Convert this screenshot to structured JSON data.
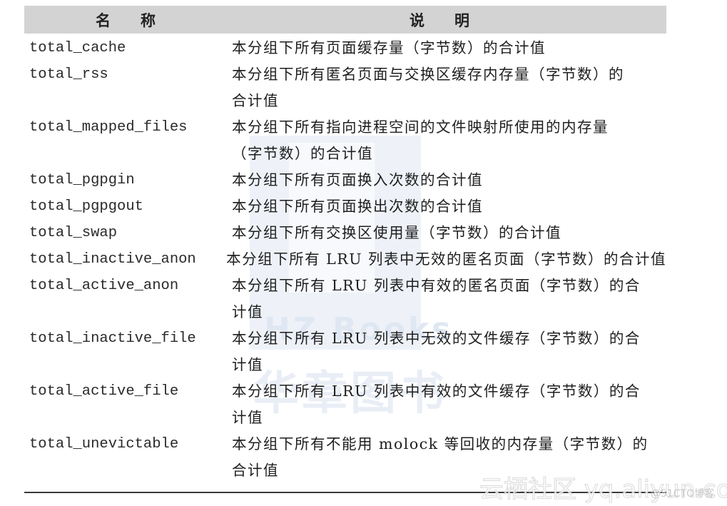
{
  "table": {
    "headers": {
      "name": "名　　称",
      "description": "说　　明"
    },
    "rows": [
      {
        "name": "total_cache",
        "description_lines": [
          "本分组下所有页面缓存量（字节数）的合计值"
        ]
      },
      {
        "name": "total_rss",
        "description_lines": [
          "本分组下所有匿名页面与交换区缓存内存量（字节数）的",
          "合计值"
        ]
      },
      {
        "name": "total_mapped_files",
        "description_lines": [
          "本分组下所有指向进程空间的文件映射所使用的内存量",
          "（字节数）的合计值"
        ]
      },
      {
        "name": "total_pgpgin",
        "description_lines": [
          "本分组下所有页面换入次数的合计值"
        ]
      },
      {
        "name": "total_pgpgout",
        "description_lines": [
          "本分组下所有页面换出次数的合计值"
        ]
      },
      {
        "name": "total_swap",
        "description_lines": [
          "本分组下所有交换区使用量（字节数）的合计值"
        ]
      },
      {
        "name": "total_inactive_anon",
        "description_lines": [
          "本分组下所有 LRU 列表中无效的匿名页面（字节数）的合计值"
        ]
      },
      {
        "name": "total_active_anon",
        "description_lines": [
          "本分组下所有 LRU 列表中有效的匿名页面（字节数）的合",
          "计值"
        ]
      },
      {
        "name": "total_inactive_file",
        "description_lines": [
          "本分组下所有 LRU 列表中无效的文件缓存（字节数）的合",
          "计值"
        ]
      },
      {
        "name": "total_active_file",
        "description_lines": [
          "本分组下所有 LRU 列表中有效的文件缓存（字节数）的合",
          "计值"
        ]
      },
      {
        "name": "total_unevictable",
        "description_lines": [
          "本分组下所有不能用 molock 等回收的内存量（字节数）的",
          "合计值"
        ]
      }
    ]
  },
  "watermarks": {
    "publisher_en": "HZ Books",
    "publisher_cn": "华章图书",
    "site": "云栖社区 yq.aliyun.com",
    "blog": "@51CTO博客"
  }
}
